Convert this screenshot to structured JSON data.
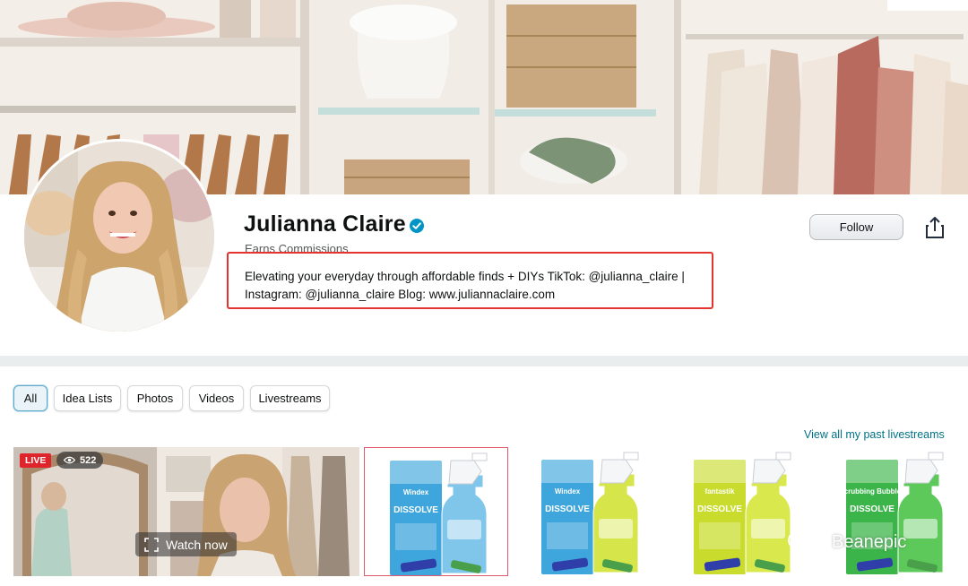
{
  "profile": {
    "name": "Julianna Claire",
    "earns": "Earns Commissions",
    "bio": "Elevating your everyday through affordable finds + DIYs TikTok: @julianna_claire | Instagram: @julianna_claire Blog: www.juliannaclaire.com",
    "follow_label": "Follow"
  },
  "tabs": [
    {
      "label": "All",
      "active": true
    },
    {
      "label": "Idea Lists",
      "active": false
    },
    {
      "label": "Photos",
      "active": false
    },
    {
      "label": "Videos",
      "active": false
    },
    {
      "label": "Livestreams",
      "active": false
    }
  ],
  "livestreams": {
    "view_all_label": "View all my past livestreams",
    "live_badge": "LIVE",
    "viewer_count": "522",
    "watch_now_label": "Watch now"
  },
  "products": [
    {
      "brand": "Windex",
      "name": "DISSOLVE",
      "liquid_color": "#7fc6ea",
      "box_color": "#3ea6dc"
    },
    {
      "brand": "Windex",
      "name": "DISSOLVE",
      "liquid_color": "#d6e64a",
      "box_color": "#3ea6dc"
    },
    {
      "brand": "fantastik",
      "name": "DISSOLVE",
      "liquid_color": "#d9e84d",
      "box_color": "#c9dc2e"
    },
    {
      "brand": "Scrubbing Bubbles",
      "name": "DISSOLVE",
      "liquid_color": "#5cc95a",
      "box_color": "#3bb54a"
    }
  ],
  "watermark": "Beanepic",
  "colors": {
    "highlight_border": "#e3342f",
    "link": "#007185",
    "verified": "#0095c5",
    "live": "#e0242b"
  }
}
